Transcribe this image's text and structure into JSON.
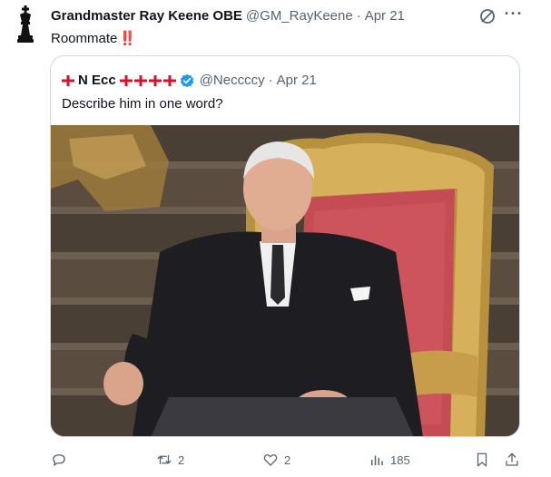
{
  "tweet": {
    "author": {
      "display_name": "Grandmaster Ray Keene OBE",
      "handle": "@GM_RayKeene",
      "separator": "·",
      "time": "Apr 21",
      "avatar_icon": "chess-king-icon"
    },
    "text": "Roommate",
    "emphasis": "‼️"
  },
  "quoted_tweet": {
    "author": {
      "display_name": "N Ecc",
      "handle": "@Neccccy",
      "separator": "·",
      "time": "Apr 21",
      "verified": true
    },
    "text": "Describe him in one word?",
    "image": {
      "description_icon": "photo-image"
    }
  },
  "actions": {
    "reply": {
      "icon": "reply-icon",
      "count": ""
    },
    "retweet": {
      "icon": "retweet-icon",
      "count": "2"
    },
    "like": {
      "icon": "heart-icon",
      "count": "2"
    },
    "views": {
      "icon": "views-icon",
      "count": "185"
    },
    "bookmark": {
      "icon": "bookmark-icon"
    },
    "share": {
      "icon": "share-icon"
    }
  },
  "colors": {
    "text_primary": "#0f1419",
    "text_secondary": "#536471",
    "verified_blue": "#1d9bf0",
    "border": "#cfd9de",
    "flag_red": "#cf142b",
    "bang_red": "#e0245e"
  }
}
